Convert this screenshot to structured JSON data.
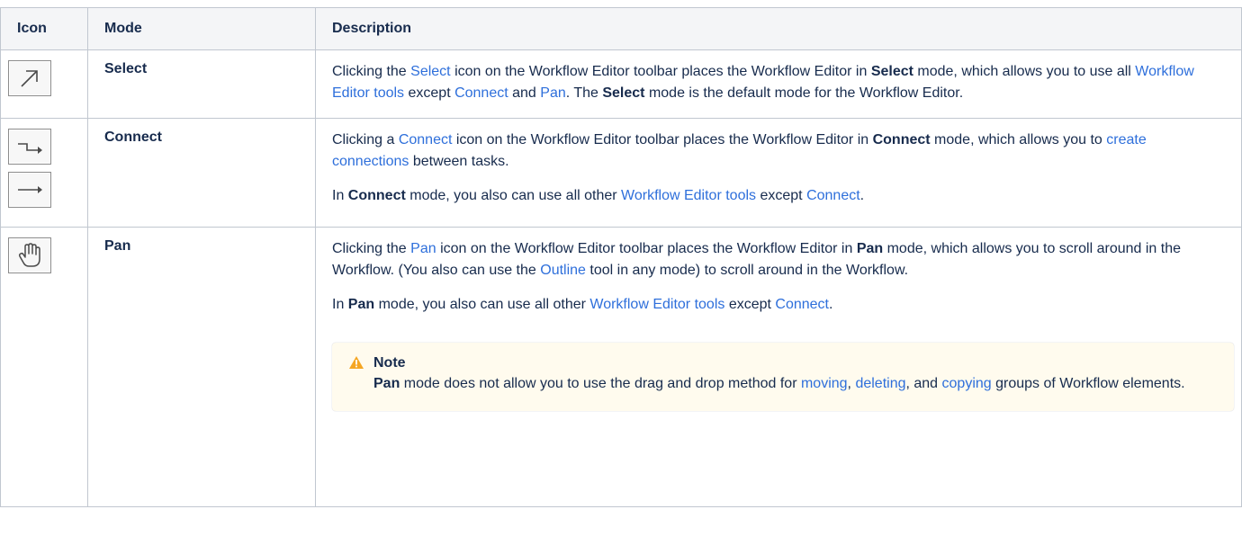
{
  "columns": [
    "Icon",
    "Mode",
    "Description"
  ],
  "colors": {
    "link": "#2e6fdb",
    "header_bg": "#f4f5f7",
    "note_bg": "#fffbee",
    "warning": "#f5a623"
  },
  "rows": [
    {
      "mode": "Select",
      "icons": [
        "select-arrow-icon"
      ],
      "paragraphs": [
        [
          {
            "t": "Clicking the "
          },
          {
            "t": "Select",
            "link": true
          },
          {
            "t": " icon on the Workflow Editor toolbar places the Workflow Editor in "
          },
          {
            "t": "Select",
            "bold": true
          },
          {
            "t": " mode, which allows you to use all "
          },
          {
            "t": "Workflow Editor tools",
            "link": true
          },
          {
            "t": " except "
          },
          {
            "t": "Connect",
            "link": true
          },
          {
            "t": " and "
          },
          {
            "t": "Pan",
            "link": true
          },
          {
            "t": ". The "
          },
          {
            "t": "Select",
            "bold": true
          },
          {
            "t": " mode is the default mode for the Workflow Editor."
          }
        ]
      ]
    },
    {
      "mode": "Connect",
      "icons": [
        "connect-elbow-icon",
        "connect-straight-icon"
      ],
      "paragraphs": [
        [
          {
            "t": "Clicking a "
          },
          {
            "t": "Connect",
            "link": true
          },
          {
            "t": " icon on the Workflow Editor toolbar places the Workflow Editor in "
          },
          {
            "t": "Connect",
            "bold": true
          },
          {
            "t": " mode, which allows you to "
          },
          {
            "t": "create connections",
            "link": true
          },
          {
            "t": " between tasks."
          }
        ],
        [
          {
            "t": "In "
          },
          {
            "t": "Connect",
            "bold": true
          },
          {
            "t": " mode, you also can use all other "
          },
          {
            "t": "Workflow Editor tools",
            "link": true
          },
          {
            "t": " except "
          },
          {
            "t": "Connect",
            "link": true
          },
          {
            "t": "."
          }
        ]
      ]
    },
    {
      "mode": "Pan",
      "icons": [
        "pan-hand-icon"
      ],
      "paragraphs": [
        [
          {
            "t": "Clicking the "
          },
          {
            "t": "Pan",
            "link": true
          },
          {
            "t": " icon on the Workflow Editor toolbar places the Workflow Editor in "
          },
          {
            "t": "Pan",
            "bold": true
          },
          {
            "t": " mode, which allows you to scroll around in the Workflow. (You also can use the "
          },
          {
            "t": "Outline",
            "link": true
          },
          {
            "t": " tool in any mode) to scroll around in the Workflow."
          }
        ],
        [
          {
            "t": "In "
          },
          {
            "t": "Pan",
            "bold": true
          },
          {
            "t": " mode, you also can use all other "
          },
          {
            "t": "Workflow Editor tools",
            "link": true
          },
          {
            "t": " except "
          },
          {
            "t": "Connect",
            "link": true
          },
          {
            "t": "."
          }
        ]
      ],
      "note": {
        "title": "Note",
        "icon": "warning-icon",
        "body": [
          {
            "t": "Pan",
            "bold": true
          },
          {
            "t": " mode does not allow you to use the drag and drop method for "
          },
          {
            "t": "moving",
            "link": true
          },
          {
            "t": ", "
          },
          {
            "t": "deleting",
            "link": true
          },
          {
            "t": ", and "
          },
          {
            "t": "copying",
            "link": true
          },
          {
            "t": " groups of Workflow elements."
          }
        ]
      }
    }
  ]
}
